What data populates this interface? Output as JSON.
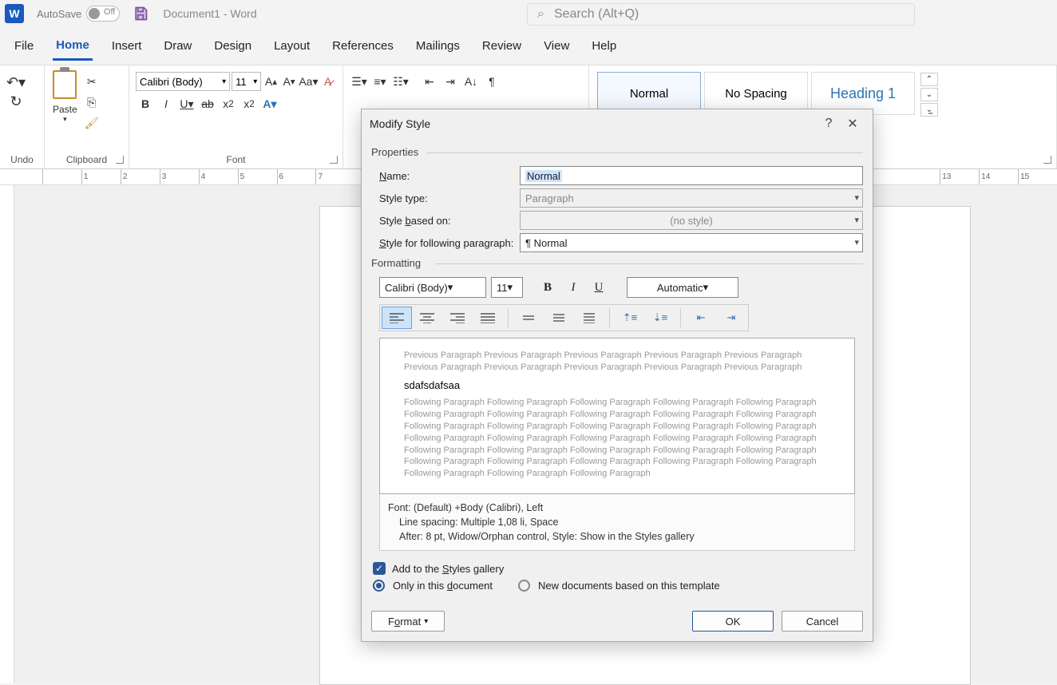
{
  "titleBar": {
    "autoSave": "AutoSave",
    "autoSaveState": "Off",
    "docTitle": "Document1  -  Word",
    "searchPlaceholder": "Search (Alt+Q)"
  },
  "menu": {
    "file": "File",
    "home": "Home",
    "insert": "Insert",
    "draw": "Draw",
    "design": "Design",
    "layout": "Layout",
    "references": "References",
    "mailings": "Mailings",
    "review": "Review",
    "view": "View",
    "help": "Help"
  },
  "ribbon": {
    "undo": "Undo",
    "clipboard": "Clipboard",
    "paste": "Paste",
    "font": "Font",
    "fontName": "Calibri (Body)",
    "fontSize": "11",
    "styles": {
      "normal": "Normal",
      "nospace": "No Spacing",
      "heading1": "Heading 1"
    }
  },
  "dialog": {
    "title": "Modify Style",
    "propsHeader": "Properties",
    "name_lbl": "Name:",
    "name_val": "Normal",
    "styletype_lbl": "Style type:",
    "styletype_val": "Paragraph",
    "basedon_lbl": "Style based on:",
    "basedon_val": "(no style)",
    "following_lbl": "Style for following paragraph:",
    "following_val": "¶ Normal",
    "formattingHeader": "Formatting",
    "fmt_font": "Calibri (Body)",
    "fmt_size": "11",
    "fmt_color": "Automatic",
    "prevText": "Previous Paragraph Previous Paragraph Previous Paragraph Previous Paragraph Previous Paragraph Previous Paragraph Previous Paragraph Previous Paragraph Previous Paragraph Previous Paragraph",
    "sample": "sdafsdafsaa",
    "follText": "Following Paragraph Following Paragraph Following Paragraph Following Paragraph Following Paragraph Following Paragraph Following Paragraph Following Paragraph Following Paragraph Following Paragraph Following Paragraph Following Paragraph Following Paragraph Following Paragraph Following Paragraph Following Paragraph Following Paragraph Following Paragraph Following Paragraph Following Paragraph Following Paragraph Following Paragraph Following Paragraph Following Paragraph Following Paragraph Following Paragraph Following Paragraph Following Paragraph Following Paragraph Following Paragraph Following Paragraph Following Paragraph Following Paragraph",
    "desc1": "Font: (Default) +Body (Calibri), Left",
    "desc2": "Line spacing:  Multiple 1,08 li, Space",
    "desc3": "After:  8 pt, Widow/Orphan control, Style: Show in the Styles gallery",
    "addGallery": "Add to the Styles gallery",
    "onlyDoc": "Only in this document",
    "newDocs": "New documents based on this template",
    "format": "Format",
    "ok": "OK",
    "cancel": "Cancel"
  }
}
